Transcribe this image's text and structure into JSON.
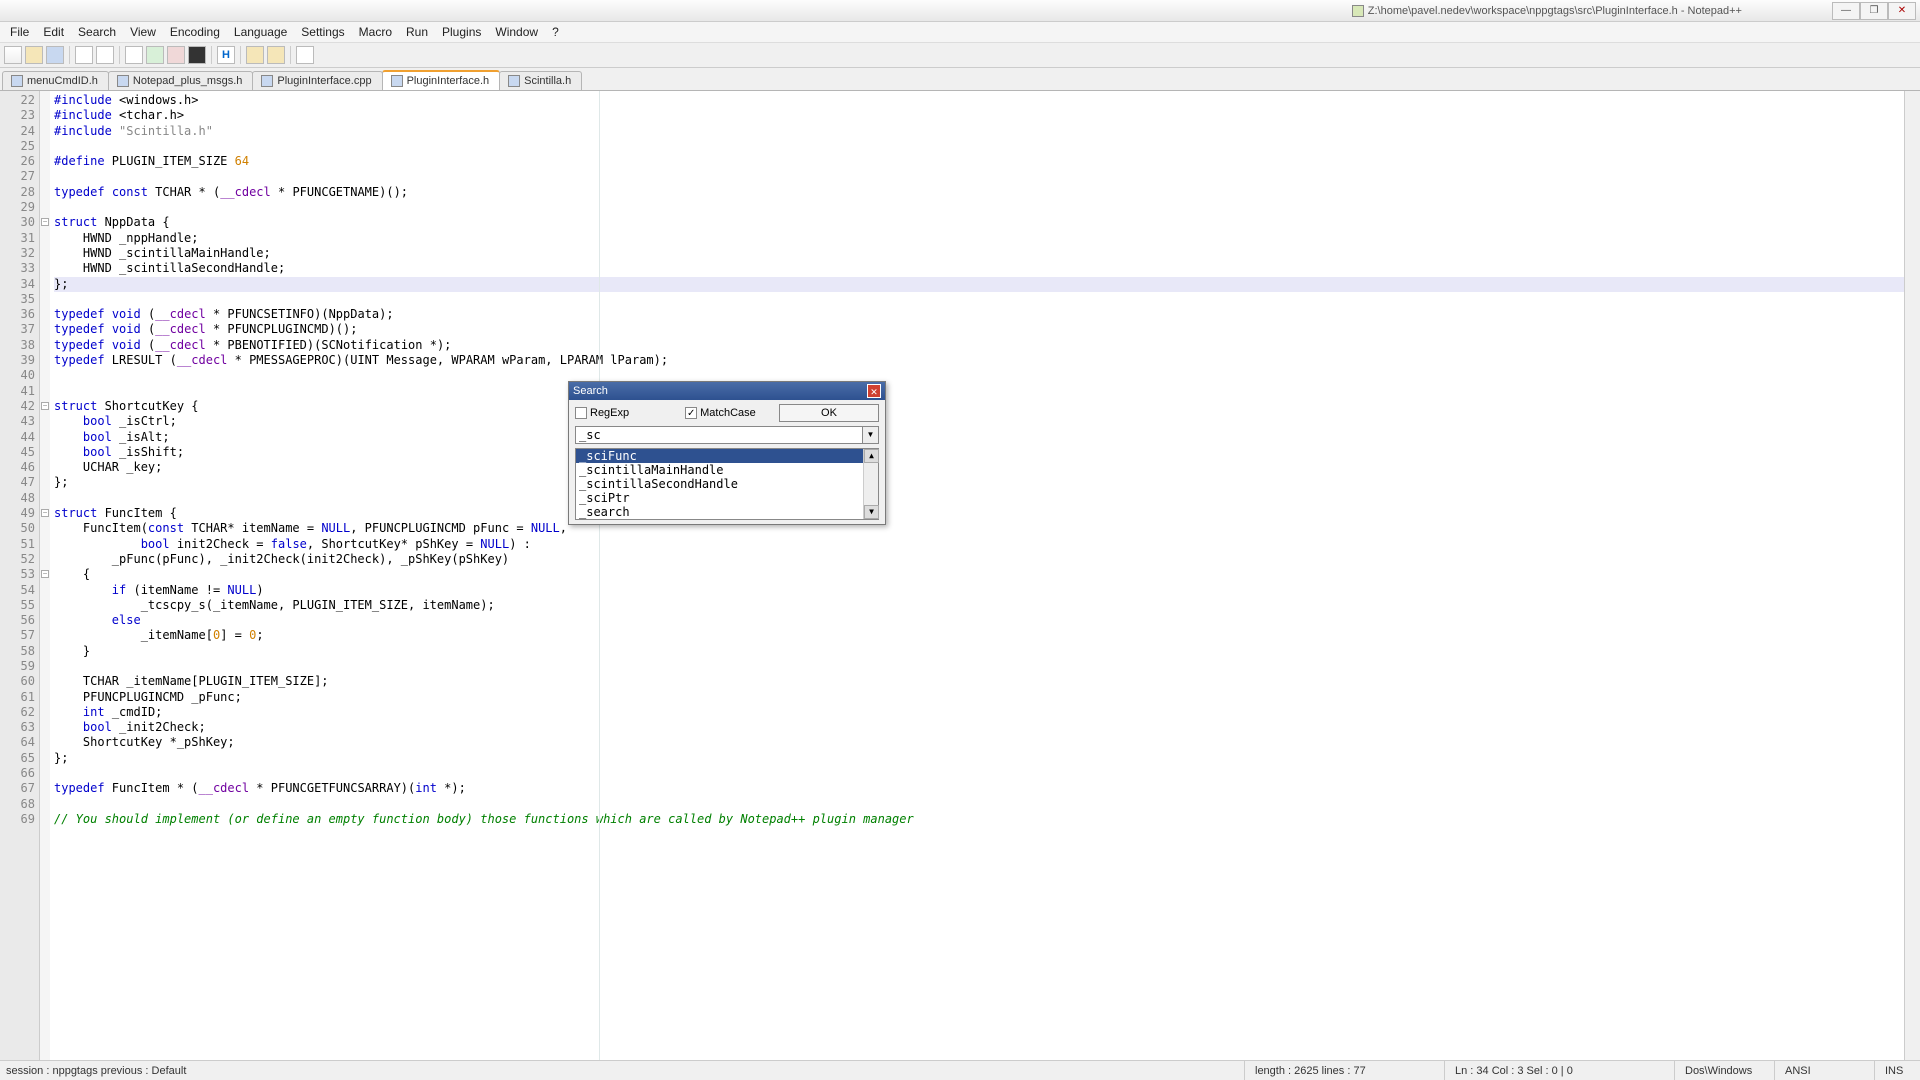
{
  "window": {
    "doc_icon": "file",
    "title": "Z:\\home\\pavel.nedev\\workspace\\nppgtags\\src\\PluginInterface.h - Notepad++"
  },
  "menus": [
    "File",
    "Edit",
    "Search",
    "View",
    "Encoding",
    "Language",
    "Settings",
    "Macro",
    "Run",
    "Plugins",
    "Window",
    "?"
  ],
  "tabs": [
    {
      "label": "menuCmdID.h",
      "active": false
    },
    {
      "label": "Notepad_plus_msgs.h",
      "active": false
    },
    {
      "label": "PluginInterface.cpp",
      "active": false
    },
    {
      "label": "PluginInterface.h",
      "active": true
    },
    {
      "label": "Scintilla.h",
      "active": false
    }
  ],
  "lines": {
    "start": 22,
    "end": 69
  },
  "code": [
    {
      "n": 22,
      "html": "<span class='kw'>#include</span> &lt;windows.h&gt;"
    },
    {
      "n": 23,
      "html": "<span class='kw'>#include</span> &lt;tchar.h&gt;"
    },
    {
      "n": 24,
      "html": "<span class='kw'>#include</span> <span class='str'>\"Scintilla.h\"</span>"
    },
    {
      "n": 25,
      "html": ""
    },
    {
      "n": 26,
      "html": "<span class='kw'>#define</span> PLUGIN_ITEM_SIZE <span class='num'>64</span>"
    },
    {
      "n": 27,
      "html": ""
    },
    {
      "n": 28,
      "html": "<span class='kw'>typedef</span> <span class='kw'>const</span> TCHAR * (<span class='type'>__cdecl</span> * PFUNCGETNAME)();"
    },
    {
      "n": 29,
      "html": ""
    },
    {
      "n": 30,
      "fold": true,
      "html": "<span class='kw'>struct</span> NppData {"
    },
    {
      "n": 31,
      "html": "    HWND _nppHandle;"
    },
    {
      "n": 32,
      "html": "    HWND _scintillaMainHandle;"
    },
    {
      "n": 33,
      "html": "    HWND _scintillaSecondHandle;"
    },
    {
      "n": 34,
      "hl": true,
      "html": "};"
    },
    {
      "n": 35,
      "html": ""
    },
    {
      "n": 36,
      "html": "<span class='kw'>typedef</span> <span class='kw'>void</span> (<span class='type'>__cdecl</span> * PFUNCSETINFO)(NppData);"
    },
    {
      "n": 37,
      "html": "<span class='kw'>typedef</span> <span class='kw'>void</span> (<span class='type'>__cdecl</span> * PFUNCPLUGINCMD)();"
    },
    {
      "n": 38,
      "html": "<span class='kw'>typedef</span> <span class='kw'>void</span> (<span class='type'>__cdecl</span> * PBENOTIFIED)(SCNotification *);"
    },
    {
      "n": 39,
      "html": "<span class='kw'>typedef</span> LRESULT (<span class='type'>__cdecl</span> * PMESSAGEPROC)(UINT Message, WPARAM wParam, LPARAM lParam);"
    },
    {
      "n": 40,
      "html": ""
    },
    {
      "n": 41,
      "html": ""
    },
    {
      "n": 42,
      "fold": true,
      "html": "<span class='kw'>struct</span> ShortcutKey {"
    },
    {
      "n": 43,
      "html": "    <span class='kw'>bool</span> _isCtrl;"
    },
    {
      "n": 44,
      "html": "    <span class='kw'>bool</span> _isAlt;"
    },
    {
      "n": 45,
      "html": "    <span class='kw'>bool</span> _isShift;"
    },
    {
      "n": 46,
      "html": "    UCHAR _key;"
    },
    {
      "n": 47,
      "html": "};"
    },
    {
      "n": 48,
      "html": ""
    },
    {
      "n": 49,
      "fold": true,
      "html": "<span class='kw'>struct</span> FuncItem {"
    },
    {
      "n": 50,
      "html": "    FuncItem(<span class='kw'>const</span> TCHAR* itemName = <span class='bool'>NULL</span>, PFUNCPLUGINCMD pFunc = <span class='bool'>NULL</span>,"
    },
    {
      "n": 51,
      "html": "            <span class='kw'>bool</span> init2Check = <span class='bool'>false</span>, ShortcutKey* pShKey = <span class='bool'>NULL</span>) :"
    },
    {
      "n": 52,
      "html": "        _pFunc(pFunc), _init2Check(init2Check), _pShKey(pShKey)"
    },
    {
      "n": 53,
      "fold": true,
      "html": "    {"
    },
    {
      "n": 54,
      "html": "        <span class='kw'>if</span> (itemName != <span class='bool'>NULL</span>)"
    },
    {
      "n": 55,
      "html": "            _tcscpy_s(_itemName, PLUGIN_ITEM_SIZE, itemName);"
    },
    {
      "n": 56,
      "html": "        <span class='kw'>else</span>"
    },
    {
      "n": 57,
      "html": "            _itemName[<span class='num'>0</span>] = <span class='num'>0</span>;"
    },
    {
      "n": 58,
      "html": "    }"
    },
    {
      "n": 59,
      "html": ""
    },
    {
      "n": 60,
      "html": "    TCHAR _itemName[PLUGIN_ITEM_SIZE];"
    },
    {
      "n": 61,
      "html": "    PFUNCPLUGINCMD _pFunc;"
    },
    {
      "n": 62,
      "html": "    <span class='kw'>int</span> _cmdID;"
    },
    {
      "n": 63,
      "html": "    <span class='kw'>bool</span> _init2Check;"
    },
    {
      "n": 64,
      "html": "    ShortcutKey *_pShKey;"
    },
    {
      "n": 65,
      "html": "};"
    },
    {
      "n": 66,
      "html": ""
    },
    {
      "n": 67,
      "html": "<span class='kw'>typedef</span> FuncItem * (<span class='type'>__cdecl</span> * PFUNCGETFUNCSARRAY)(<span class='kw'>int</span> *);"
    },
    {
      "n": 68,
      "html": ""
    },
    {
      "n": 69,
      "html": "<span class='cmt'>// You should implement (or define an empty function body) those functions which are called by Notepad++ plugin manager</span>"
    }
  ],
  "search": {
    "title": "Search",
    "regexp_label": "RegExp",
    "regexp_checked": false,
    "matchcase_label": "MatchCase",
    "matchcase_checked": true,
    "ok_label": "OK",
    "input_value": "_sc",
    "items": [
      {
        "label": "_sciFunc",
        "selected": true
      },
      {
        "label": "_scintillaMainHandle",
        "selected": false
      },
      {
        "label": "_scintillaSecondHandle",
        "selected": false
      },
      {
        "label": "_sciPtr",
        "selected": false
      },
      {
        "label": "_search",
        "selected": false
      }
    ]
  },
  "status": {
    "left": "session : nppgtags    previous : Default",
    "length": "length : 2625    lines : 77",
    "pos": "Ln : 34    Col : 3    Sel : 0 | 0",
    "eol": "Dos\\Windows",
    "enc": "ANSI",
    "mode": "INS"
  }
}
